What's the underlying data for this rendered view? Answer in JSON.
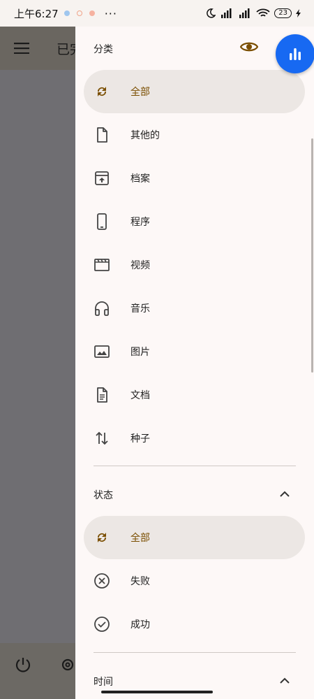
{
  "status_bar": {
    "time": "上午6:27",
    "more": "···",
    "battery": "23"
  },
  "background": {
    "title": "已完"
  },
  "drawer": {
    "category_title": "分类",
    "categories": [
      {
        "label": "全部",
        "icon": "sync-icon",
        "selected": true
      },
      {
        "label": "其他的",
        "icon": "file-icon",
        "selected": false
      },
      {
        "label": "档案",
        "icon": "archive-icon",
        "selected": false
      },
      {
        "label": "程序",
        "icon": "phone-icon",
        "selected": false
      },
      {
        "label": "视频",
        "icon": "movie-icon",
        "selected": false
      },
      {
        "label": "音乐",
        "icon": "headphones-icon",
        "selected": false
      },
      {
        "label": "图片",
        "icon": "image-icon",
        "selected": false
      },
      {
        "label": "文档",
        "icon": "document-icon",
        "selected": false
      },
      {
        "label": "种子",
        "icon": "swap-vertical-icon",
        "selected": false
      }
    ],
    "status_title": "状态",
    "statuses": [
      {
        "label": "全部",
        "icon": "sync-icon",
        "selected": true
      },
      {
        "label": "失败",
        "icon": "cancel-circle-icon",
        "selected": false
      },
      {
        "label": "成功",
        "icon": "check-circle-icon",
        "selected": false
      }
    ],
    "time_title": "时间"
  },
  "colors": {
    "accent": "#7a4e00",
    "fab": "#1769f2",
    "selected_bg": "#ece7e4",
    "drawer_bg": "#fdf8f7"
  }
}
